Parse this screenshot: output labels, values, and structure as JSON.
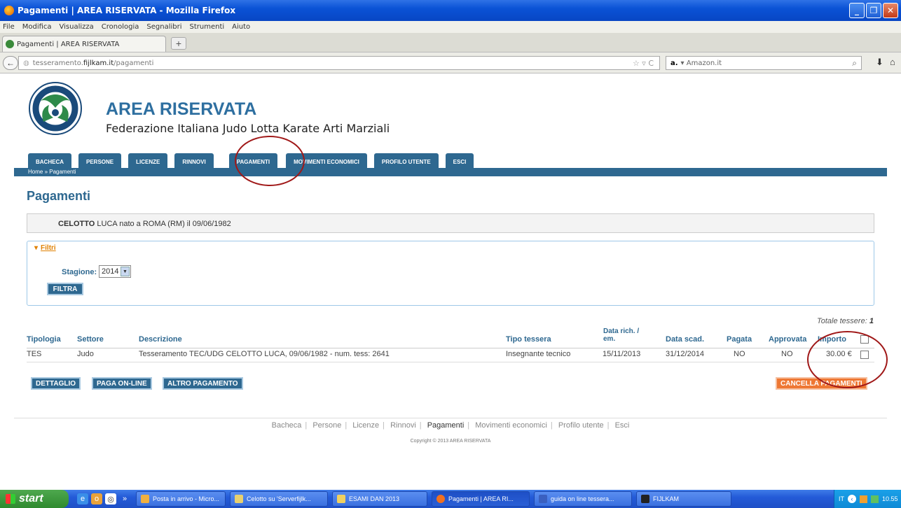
{
  "window": {
    "title": "Pagamenti | AREA RISERVATA - Mozilla Firefox",
    "btn_min": "_",
    "btn_max": "❐",
    "btn_close": "✕"
  },
  "menu": [
    "File",
    "Modifica",
    "Visualizza",
    "Cronologia",
    "Segnalibri",
    "Strumenti",
    "Aiuto"
  ],
  "tab": {
    "title": "Pagamenti | AREA RISERVATA",
    "new_tab": "+"
  },
  "nav": {
    "back": "←",
    "url_prefix": "tesseramento.",
    "url_domain": "fijlkam.it",
    "url_path": "/pagamenti",
    "url_icons": "☆ ▿ C",
    "search_engine": "a.",
    "search_placeholder": "▾ Amazon.it",
    "search_icon": "⌕",
    "download_icon": "⬇",
    "home_icon": "⌂"
  },
  "header": {
    "title": "AREA RISERVATA",
    "subtitle": "Federazione Italiana Judo Lotta Karate Arti Marziali"
  },
  "main_nav": [
    "BACHECA",
    "PERSONE",
    "LICENZE",
    "RINNOVI",
    "PAGAMENTI",
    "MOVIMENTI ECONOMICI",
    "PROFILO UTENTE",
    "ESCI"
  ],
  "breadcrumb": "Home » Pagamenti",
  "page_title": "Pagamenti",
  "person": {
    "surname": "CELOTTO",
    "rest": " LUCA nato a ROMA (RM) il 09/06/1982"
  },
  "filters": {
    "heading": "Filtri",
    "season_label": "Stagione:",
    "season_value": "2014",
    "submit": "FILTRA",
    "arrow": "▾",
    "select_arrow": "▼"
  },
  "totals": {
    "label": "Totale tessere: ",
    "value": "1"
  },
  "table": {
    "headers": [
      "Tipologia",
      "Settore",
      "Descrizione",
      "Tipo tessera",
      "Data rich. / em.",
      "Data scad.",
      "Pagata",
      "Approvata",
      "Importo"
    ],
    "rows": [
      {
        "tipologia": "TES",
        "settore": "Judo",
        "descrizione": "Tesseramento TEC/UDG CELOTTO LUCA, 09/06/1982 - num. tess: 2641",
        "tipo": "Insegnante tecnico",
        "data_rich": "15/11/2013",
        "data_scad": "31/12/2014",
        "pagata": "NO",
        "approvata": "NO",
        "importo": "30.00 €"
      }
    ]
  },
  "actions": {
    "dettaglio": "DETTAGLIO",
    "paga_online": "PAGA ON-LINE",
    "altro": "ALTRO PAGAMENTO",
    "cancella": "CANCELLA PAGAMENTI"
  },
  "footer": {
    "links": [
      "Bacheca",
      "Persone",
      "Licenze",
      "Rinnovi",
      "Pagamenti",
      "Movimenti economici",
      "Profilo utente",
      "Esci"
    ],
    "active": "Pagamenti",
    "copyright": "Copyright © 2013 AREA RISERVATA"
  },
  "taskbar": {
    "start": "start",
    "quick_more": "»",
    "buttons": [
      "Posta in arrivo - Micro...",
      "Celotto su 'Serverfijlk...",
      "ESAMI DAN 2013",
      "Pagamenti | AREA RI...",
      "guida on line tessera...",
      "FIJLKAM"
    ],
    "active": "Pagamenti | AREA RI...",
    "lang": "IT",
    "clock": "10.55"
  },
  "colors": {
    "accent": "#2e6890",
    "orange": "#ee7733",
    "annotation": "#a01818"
  }
}
